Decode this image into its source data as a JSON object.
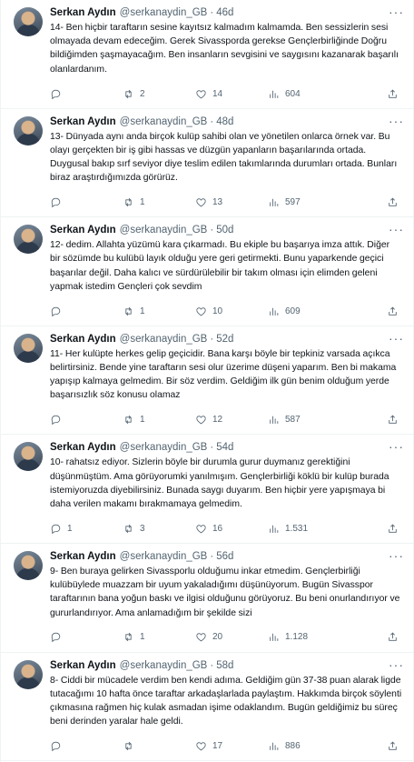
{
  "tweets": [
    {
      "name": "Serkan Aydın",
      "handle": "@serkanaydin_GB",
      "time": "46d",
      "text": "14- Ben hiçbir taraftarın sesine kayıtsız kalmadım kalmamda. Ben sessizlerin sesi olmayada devam edeceğim. Gerek Sivassporda gerekse Gençlerbirliğinde Doğru bildiğimden şaşmayacağım. Ben insanların sevgisini ve saygısını kazanarak başarılı olanlardanım.",
      "replies": "",
      "retweets": "2",
      "likes": "14",
      "views": "604"
    },
    {
      "name": "Serkan Aydın",
      "handle": "@serkanaydin_GB",
      "time": "48d",
      "text": "13- Dünyada aynı anda birçok kulüp sahibi olan ve yönetilen onlarca örnek var. Bu olayı gerçekten bir iş gibi hassas ve düzgün yapanların başarılarında ortada. Duygusal bakıp sırf seviyor diye teslim edilen takımlarında durumları ortada. Bunları biraz araştırdığımızda görürüz.",
      "replies": "",
      "retweets": "1",
      "likes": "13",
      "views": "597"
    },
    {
      "name": "Serkan Aydın",
      "handle": "@serkanaydin_GB",
      "time": "50d",
      "text": "12- dedim. Allahta yüzümü kara çıkarmadı. Bu ekiple bu başarıya imza attık. Diğer bir sözümde bu kulübü layık olduğu yere geri getirmekti. Bunu yaparkende geçici başarılar değil. Daha kalıcı ve sürdürülebilir bir takım olması için elimden geleni yapmak istedim Gençleri çok sevdim",
      "replies": "",
      "retweets": "1",
      "likes": "10",
      "views": "609"
    },
    {
      "name": "Serkan Aydın",
      "handle": "@serkanaydin_GB",
      "time": "52d",
      "text": "11- Her kulüpte herkes gelip geçicidir. Bana karşı böyle bir tepkiniz varsada açıkca belirtirsiniz. Bende yine taraftarın sesi olur üzerime düşeni yaparım. Ben bi makama yapışıp kalmaya gelmedim. Bir söz verdim. Geldiğim ilk gün benim olduğum yerde başarısızlık söz konusu olamaz",
      "replies": "",
      "retweets": "1",
      "likes": "12",
      "views": "587"
    },
    {
      "name": "Serkan Aydın",
      "handle": "@serkanaydin_GB",
      "time": "54d",
      "text": "10- rahatsız ediyor. Sizlerin böyle bir durumla gurur duymanız gerektiğini düşünmüştüm. Ama görüyorumki yanılmışım. Gençlerbirliği köklü bir kulüp burada istemiyoruzda diyebilirsiniz. Bunada saygı duyarım. Ben hiçbir yere yapışmaya bi daha verilen makamı bırakmamaya gelmedim.",
      "replies": "1",
      "retweets": "3",
      "likes": "16",
      "views": "1.531"
    },
    {
      "name": "Serkan Aydın",
      "handle": "@serkanaydin_GB",
      "time": "56d",
      "text": "9- Ben buraya gelirken Sivassporlu olduğumu inkar etmedim. Gençlerbirliği kulübüylede muazzam bir uyum yakaladığımı düşünüyorum. Bugün Sivasspor taraftarının bana yoğun baskı ve ilgisi olduğunu görüyoruz. Bu beni onurlandırıyor ve gururlandırıyor. Ama anlamadığım bir şekilde sizi",
      "replies": "",
      "retweets": "1",
      "likes": "20",
      "views": "1.128"
    },
    {
      "name": "Serkan Aydın",
      "handle": "@serkanaydin_GB",
      "time": "58d",
      "text": "8- Ciddi bir mücadele verdim ben kendi adıma. Geldiğim gün 37-38 puan alarak ligde tutacağımı 10 hafta önce taraftar arkadaşlarlada paylaştım. Hakkımda birçok söylenti çıkmasına rağmen hiç kulak asmadan işime odaklandım. Bugün geldiğimiz bu süreç beni derinden yaralar hale geldi.",
      "replies": "",
      "retweets": "",
      "likes": "17",
      "views": "886"
    }
  ],
  "ui": {
    "dot": "·",
    "more": "···",
    "icons": [
      "reply-icon",
      "retweet-icon",
      "like-icon",
      "views-icon",
      "share-icon"
    ],
    "colors": {
      "text": "#0f1419",
      "secondary": "#536471",
      "border": "#eff3f4"
    }
  }
}
